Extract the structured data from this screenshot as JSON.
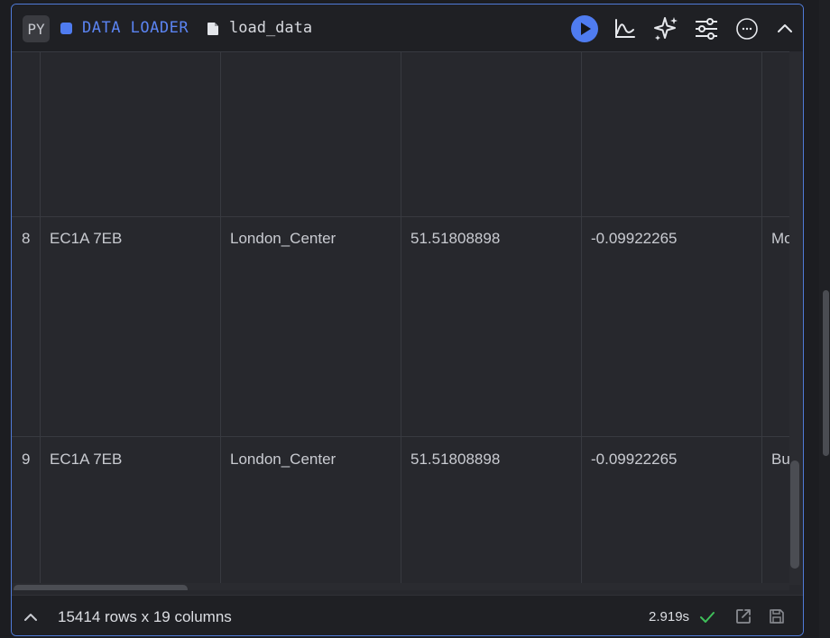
{
  "header": {
    "lang_badge": "PY",
    "block_type": "DATA LOADER",
    "block_name": "load_data",
    "accent_color": "#4f7cf0"
  },
  "table": {
    "rows": [
      {
        "index": "",
        "cells": [
          "",
          "",
          "",
          "",
          ""
        ]
      },
      {
        "index": "8",
        "cells": [
          "EC1A 7EB",
          "London_Center",
          "51.51808898",
          "-0.09922265",
          "Mo Lo"
        ]
      },
      {
        "index": "9",
        "cells": [
          "EC1A 7EB",
          "London_Center",
          "51.51808898",
          "-0.09922265",
          "Bu"
        ]
      }
    ]
  },
  "footer": {
    "row_count": "15414 rows x 19 columns",
    "exec_time": "2.919s",
    "status_color": "#3fbf5a"
  },
  "icons": [
    "play-icon",
    "chart-icon",
    "sparkle-icon",
    "sliders-icon",
    "more-icon",
    "chevron-up-icon",
    "file-icon",
    "check-icon",
    "external-link-icon",
    "save-icon"
  ]
}
